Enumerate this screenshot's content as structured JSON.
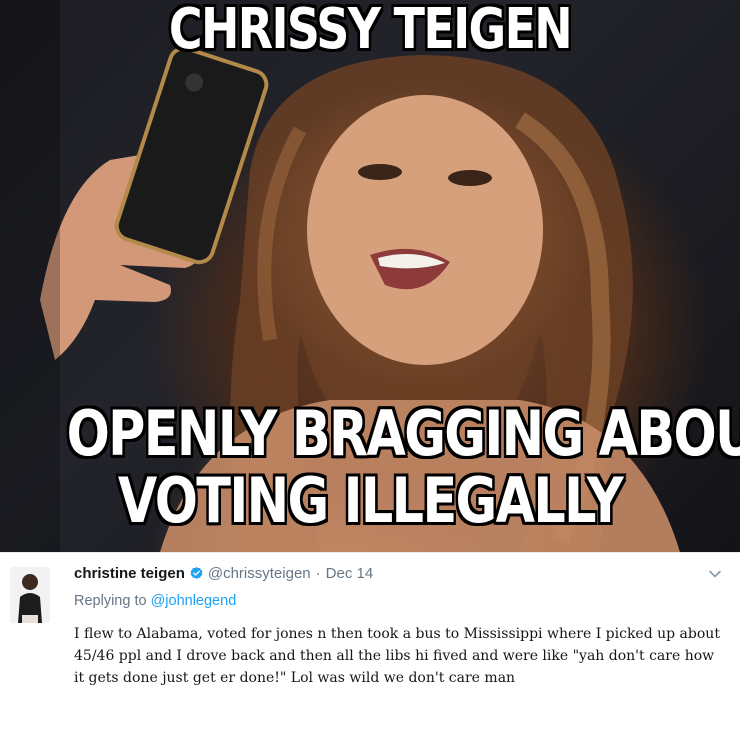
{
  "meme": {
    "top_caption": "CHRISSY TEIGEN",
    "bottom_caption_line1": "OPENLY BRAGGING ABOUT",
    "bottom_caption_line2": "VOTING ILLEGALLY"
  },
  "tweet": {
    "display_name": "christine teigen",
    "handle": "@chrissyteigen",
    "separator": "·",
    "date": "Dec 14",
    "reply_prefix": "Replying to",
    "reply_to": "@johnlegend",
    "text": "I flew to Alabama, voted for jones n then took a bus to Mississippi where I picked up about 45/46 ppl and I drove back and then all the libs hi fived and were like \"yah don't care how it gets done just get er done!\" Lol was wild we don't care man"
  },
  "colors": {
    "verified": "#1da1f2",
    "mention": "#1da1f2",
    "muted": "#657786",
    "text": "#14171a"
  },
  "icons": {
    "verified": "verified-badge-icon",
    "menu": "chevron-down-icon"
  }
}
